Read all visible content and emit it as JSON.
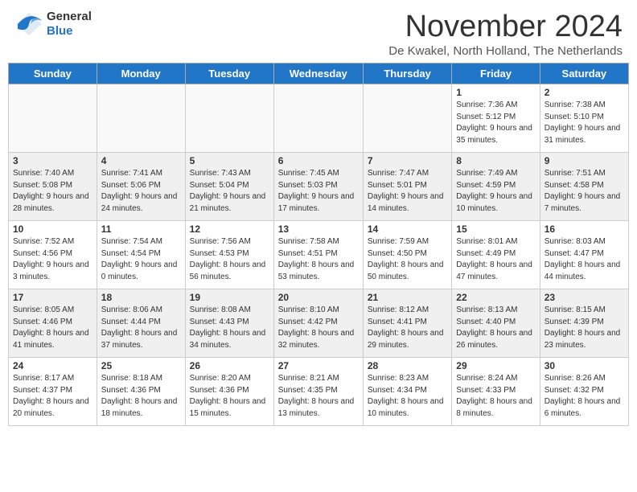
{
  "header": {
    "logo_general": "General",
    "logo_blue": "Blue",
    "month_title": "November 2024",
    "location": "De Kwakel, North Holland, The Netherlands"
  },
  "calendar": {
    "days_of_week": [
      "Sunday",
      "Monday",
      "Tuesday",
      "Wednesday",
      "Thursday",
      "Friday",
      "Saturday"
    ],
    "weeks": [
      [
        {
          "day": "",
          "empty": true
        },
        {
          "day": "",
          "empty": true
        },
        {
          "day": "",
          "empty": true
        },
        {
          "day": "",
          "empty": true
        },
        {
          "day": "",
          "empty": true
        },
        {
          "day": "1",
          "sunrise": "Sunrise: 7:36 AM",
          "sunset": "Sunset: 5:12 PM",
          "daylight": "Daylight: 9 hours and 35 minutes."
        },
        {
          "day": "2",
          "sunrise": "Sunrise: 7:38 AM",
          "sunset": "Sunset: 5:10 PM",
          "daylight": "Daylight: 9 hours and 31 minutes."
        }
      ],
      [
        {
          "day": "3",
          "sunrise": "Sunrise: 7:40 AM",
          "sunset": "Sunset: 5:08 PM",
          "daylight": "Daylight: 9 hours and 28 minutes."
        },
        {
          "day": "4",
          "sunrise": "Sunrise: 7:41 AM",
          "sunset": "Sunset: 5:06 PM",
          "daylight": "Daylight: 9 hours and 24 minutes."
        },
        {
          "day": "5",
          "sunrise": "Sunrise: 7:43 AM",
          "sunset": "Sunset: 5:04 PM",
          "daylight": "Daylight: 9 hours and 21 minutes."
        },
        {
          "day": "6",
          "sunrise": "Sunrise: 7:45 AM",
          "sunset": "Sunset: 5:03 PM",
          "daylight": "Daylight: 9 hours and 17 minutes."
        },
        {
          "day": "7",
          "sunrise": "Sunrise: 7:47 AM",
          "sunset": "Sunset: 5:01 PM",
          "daylight": "Daylight: 9 hours and 14 minutes."
        },
        {
          "day": "8",
          "sunrise": "Sunrise: 7:49 AM",
          "sunset": "Sunset: 4:59 PM",
          "daylight": "Daylight: 9 hours and 10 minutes."
        },
        {
          "day": "9",
          "sunrise": "Sunrise: 7:51 AM",
          "sunset": "Sunset: 4:58 PM",
          "daylight": "Daylight: 9 hours and 7 minutes."
        }
      ],
      [
        {
          "day": "10",
          "sunrise": "Sunrise: 7:52 AM",
          "sunset": "Sunset: 4:56 PM",
          "daylight": "Daylight: 9 hours and 3 minutes."
        },
        {
          "day": "11",
          "sunrise": "Sunrise: 7:54 AM",
          "sunset": "Sunset: 4:54 PM",
          "daylight": "Daylight: 9 hours and 0 minutes."
        },
        {
          "day": "12",
          "sunrise": "Sunrise: 7:56 AM",
          "sunset": "Sunset: 4:53 PM",
          "daylight": "Daylight: 8 hours and 56 minutes."
        },
        {
          "day": "13",
          "sunrise": "Sunrise: 7:58 AM",
          "sunset": "Sunset: 4:51 PM",
          "daylight": "Daylight: 8 hours and 53 minutes."
        },
        {
          "day": "14",
          "sunrise": "Sunrise: 7:59 AM",
          "sunset": "Sunset: 4:50 PM",
          "daylight": "Daylight: 8 hours and 50 minutes."
        },
        {
          "day": "15",
          "sunrise": "Sunrise: 8:01 AM",
          "sunset": "Sunset: 4:49 PM",
          "daylight": "Daylight: 8 hours and 47 minutes."
        },
        {
          "day": "16",
          "sunrise": "Sunrise: 8:03 AM",
          "sunset": "Sunset: 4:47 PM",
          "daylight": "Daylight: 8 hours and 44 minutes."
        }
      ],
      [
        {
          "day": "17",
          "sunrise": "Sunrise: 8:05 AM",
          "sunset": "Sunset: 4:46 PM",
          "daylight": "Daylight: 8 hours and 41 minutes."
        },
        {
          "day": "18",
          "sunrise": "Sunrise: 8:06 AM",
          "sunset": "Sunset: 4:44 PM",
          "daylight": "Daylight: 8 hours and 37 minutes."
        },
        {
          "day": "19",
          "sunrise": "Sunrise: 8:08 AM",
          "sunset": "Sunset: 4:43 PM",
          "daylight": "Daylight: 8 hours and 34 minutes."
        },
        {
          "day": "20",
          "sunrise": "Sunrise: 8:10 AM",
          "sunset": "Sunset: 4:42 PM",
          "daylight": "Daylight: 8 hours and 32 minutes."
        },
        {
          "day": "21",
          "sunrise": "Sunrise: 8:12 AM",
          "sunset": "Sunset: 4:41 PM",
          "daylight": "Daylight: 8 hours and 29 minutes."
        },
        {
          "day": "22",
          "sunrise": "Sunrise: 8:13 AM",
          "sunset": "Sunset: 4:40 PM",
          "daylight": "Daylight: 8 hours and 26 minutes."
        },
        {
          "day": "23",
          "sunrise": "Sunrise: 8:15 AM",
          "sunset": "Sunset: 4:39 PM",
          "daylight": "Daylight: 8 hours and 23 minutes."
        }
      ],
      [
        {
          "day": "24",
          "sunrise": "Sunrise: 8:17 AM",
          "sunset": "Sunset: 4:37 PM",
          "daylight": "Daylight: 8 hours and 20 minutes."
        },
        {
          "day": "25",
          "sunrise": "Sunrise: 8:18 AM",
          "sunset": "Sunset: 4:36 PM",
          "daylight": "Daylight: 8 hours and 18 minutes."
        },
        {
          "day": "26",
          "sunrise": "Sunrise: 8:20 AM",
          "sunset": "Sunset: 4:36 PM",
          "daylight": "Daylight: 8 hours and 15 minutes."
        },
        {
          "day": "27",
          "sunrise": "Sunrise: 8:21 AM",
          "sunset": "Sunset: 4:35 PM",
          "daylight": "Daylight: 8 hours and 13 minutes."
        },
        {
          "day": "28",
          "sunrise": "Sunrise: 8:23 AM",
          "sunset": "Sunset: 4:34 PM",
          "daylight": "Daylight: 8 hours and 10 minutes."
        },
        {
          "day": "29",
          "sunrise": "Sunrise: 8:24 AM",
          "sunset": "Sunset: 4:33 PM",
          "daylight": "Daylight: 8 hours and 8 minutes."
        },
        {
          "day": "30",
          "sunrise": "Sunrise: 8:26 AM",
          "sunset": "Sunset: 4:32 PM",
          "daylight": "Daylight: 8 hours and 6 minutes."
        }
      ]
    ]
  }
}
